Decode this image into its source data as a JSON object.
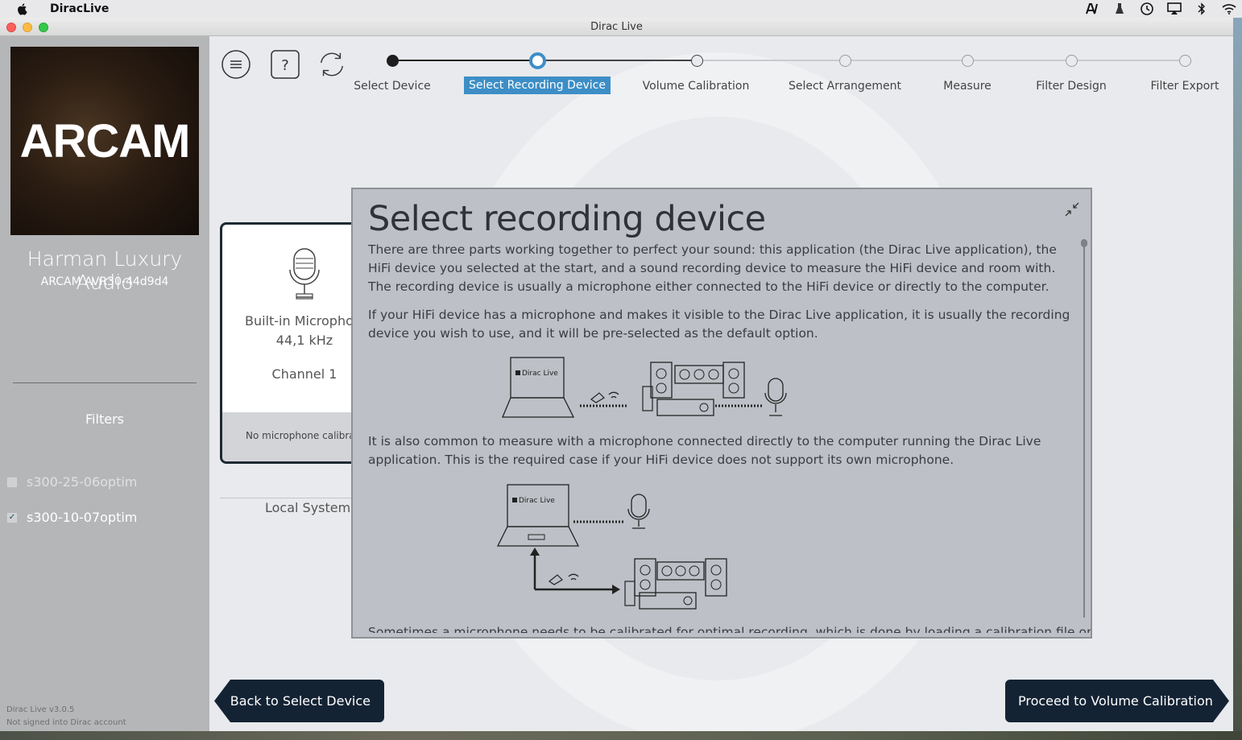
{
  "menubar": {
    "app_name": "DiracLive"
  },
  "window": {
    "title": "Dirac Live"
  },
  "sidebar": {
    "logo_text": "ARCAM",
    "brand": "Harman Luxury Audio",
    "device": "ARCAM AVR30-44d9d4",
    "filters_heading": "Filters",
    "filters": [
      {
        "label": "s300-25-06optim",
        "checked": false
      },
      {
        "label": "s300-10-07optim",
        "checked": true
      }
    ],
    "version": "Dirac Live v3.0.5",
    "account_status": "Not signed into Dirac account"
  },
  "stepper": {
    "steps": [
      {
        "label": "Select Device",
        "state": "done"
      },
      {
        "label": "Select Recording Device",
        "state": "active"
      },
      {
        "label": "Volume Calibration",
        "state": "pending"
      },
      {
        "label": "Select Arrangement",
        "state": "pending"
      },
      {
        "label": "Measure",
        "state": "pending"
      },
      {
        "label": "Filter Design",
        "state": "pending"
      },
      {
        "label": "Filter Export",
        "state": "pending"
      }
    ]
  },
  "device_card": {
    "name": "Built-in Microphone",
    "sample_rate": "44,1 kHz",
    "channel": "Channel 1",
    "calibration": "No microphone calibration",
    "group_label": "Local System"
  },
  "help_popup": {
    "title": "Select recording device",
    "para1": "There are three parts working together to perfect your sound: this application (the Dirac Live application), the HiFi device you selected at the start, and a sound recording device to measure the HiFi device and room with. The recording device is usually a microphone either connected to the HiFi device or directly to the computer.",
    "para2": "If your HiFi device has a microphone and makes it visible to the Dirac Live application, it is usually the recording device you wish to use, and it will be pre-selected as the default option.",
    "para3": "It is also common to measure with a microphone connected directly to the computer running the Dirac Live application. This is the required case if your HiFi device does not support its own microphone.",
    "laptop_label": "Dirac Live",
    "cut_text": "Sometimes a microphone needs to be calibrated for optimal recording, which is done by loading a calibration file on the"
  },
  "nav": {
    "back": "Back to Select Device",
    "next": "Proceed to Volume Calibration"
  },
  "colors": {
    "accent": "#3d8ec6",
    "nav_bg": "#142334",
    "sidebar_bg": "#b5b6b8"
  }
}
